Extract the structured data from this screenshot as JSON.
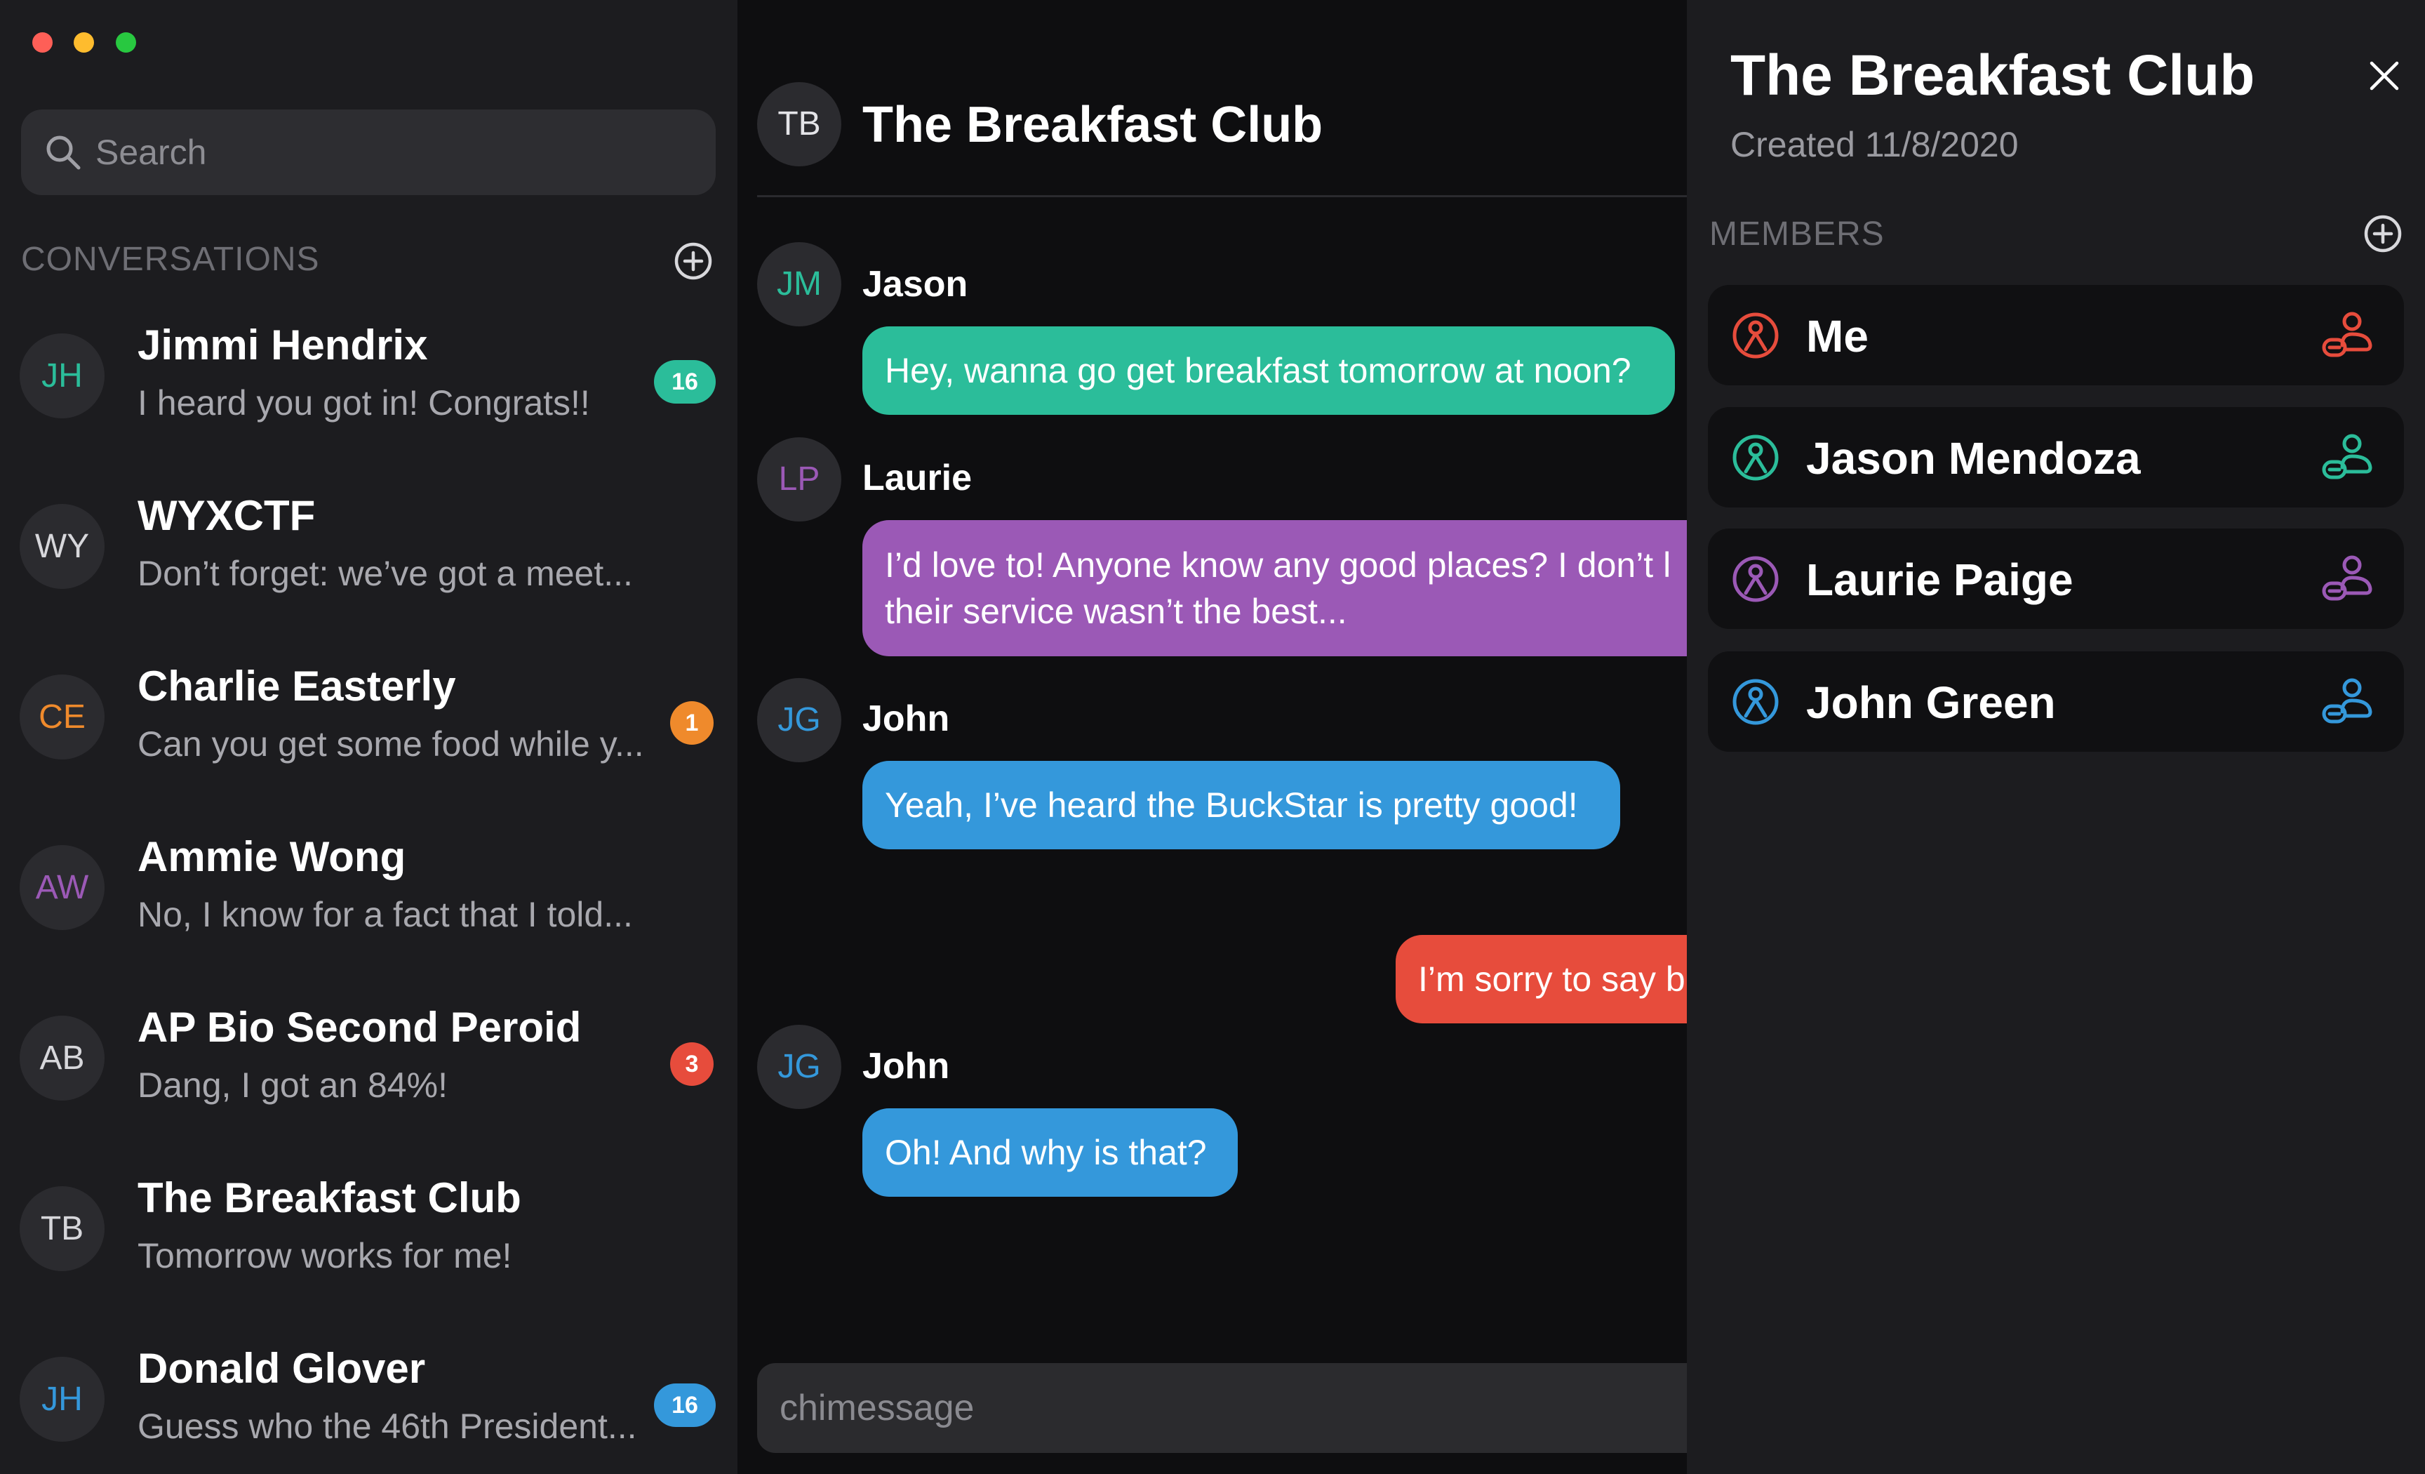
{
  "window": {
    "controls": [
      "close",
      "minimize",
      "maximize"
    ]
  },
  "sidebar": {
    "search_placeholder": "Search",
    "conversations_header": "CONVERSATIONS",
    "conversations": [
      {
        "initials": "JH",
        "name": "Jimmi Hendrix",
        "preview": "I heard you got in! Congrats!!",
        "badge": "16",
        "badge_color": "#2bbd9a",
        "avatar_color": "#2bbd9a"
      },
      {
        "initials": "WY",
        "name": "WYXCTF",
        "preview": "Don’t forget: we’ve got a meet...",
        "badge": "",
        "badge_color": "",
        "avatar_color": "#d7d7db"
      },
      {
        "initials": "CE",
        "name": "Charlie Easterly",
        "preview": "Can you get some food while y...",
        "badge": "1",
        "badge_color": "#ef8a2c",
        "avatar_color": "#ef8a2c"
      },
      {
        "initials": "AW",
        "name": "Ammie Wong",
        "preview": "No, I know for a fact that I told...",
        "badge": "",
        "badge_color": "",
        "avatar_color": "#9b59b6"
      },
      {
        "initials": "AB",
        "name": "AP Bio Second Peroid",
        "preview": "Dang, I got an 84%!",
        "badge": "3",
        "badge_color": "#e74c3c",
        "avatar_color": "#d7d7db"
      },
      {
        "initials": "TB",
        "name": "The Breakfast Club",
        "preview": "Tomorrow works for me!",
        "badge": "",
        "badge_color": "",
        "avatar_color": "#d7d7db"
      },
      {
        "initials": "JH",
        "name": "Donald Glover",
        "preview": "Guess who the 46th President...",
        "badge": "16",
        "badge_color": "#3498db",
        "avatar_color": "#3498db"
      }
    ]
  },
  "chat": {
    "initials": "TB",
    "title": "The Breakfast Club",
    "messages": [
      {
        "initials": "JM",
        "sender": "Jason",
        "text": "Hey, wanna go get breakfast tomorrow at noon?",
        "color": "#2bbd9a",
        "outgoing": false
      },
      {
        "initials": "LP",
        "sender": "Laurie",
        "lines": [
          "I’d love to! Anyone know any good places? I don’t l",
          "their service wasn’t the best..."
        ],
        "color": "#9b59b6",
        "outgoing": false
      },
      {
        "initials": "JG",
        "sender": "John",
        "text": "Yeah, I’ve heard the BuckStar is pretty good!",
        "color": "#3498db",
        "outgoing": false
      },
      {
        "initials": "",
        "sender": "",
        "text": "I’m sorry to say b",
        "color": "#e74c3c",
        "outgoing": true
      },
      {
        "initials": "JG",
        "sender": "John",
        "text": "Oh! And why is that?",
        "color": "#3498db",
        "outgoing": false
      }
    ],
    "composer_placeholder": "chimessage"
  },
  "details": {
    "title": "The Breakfast Club",
    "created": "Created 11/8/2020",
    "members_header": "MEMBERS",
    "members": [
      {
        "name": "Me",
        "color": "#e74c3c",
        "icon": "person-icon",
        "action_icon": "remove-member-icon"
      },
      {
        "name": "Jason Mendoza",
        "color": "#2bbd9a",
        "icon": "person-icon",
        "action_icon": "remove-member-icon"
      },
      {
        "name": "Laurie Paige",
        "color": "#9b59b6",
        "icon": "person-icon",
        "action_icon": "remove-member-icon"
      },
      {
        "name": "John Green",
        "color": "#3498db",
        "icon": "person-icon",
        "action_icon": "remove-member-icon"
      }
    ]
  }
}
